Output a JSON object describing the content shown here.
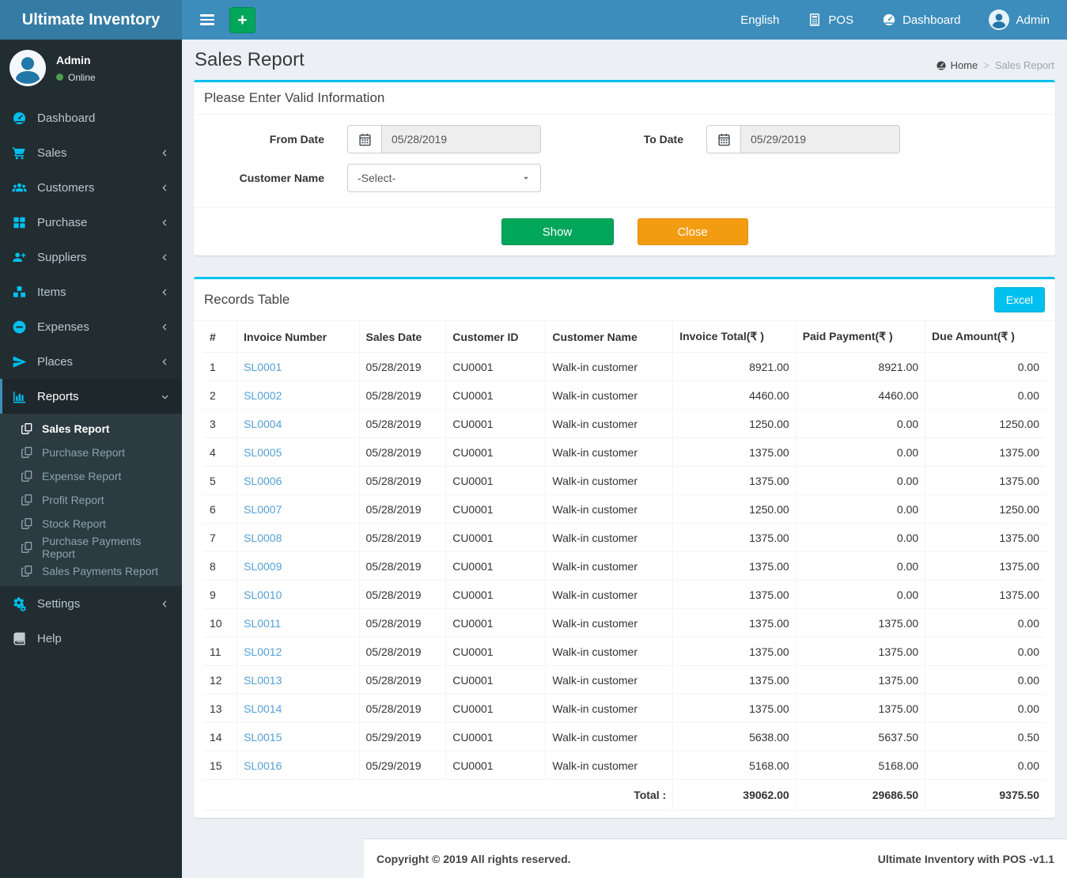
{
  "app": {
    "brand": "Ultimate Inventory",
    "footer_left": "Copyright © 2019 All rights reserved.",
    "footer_right": "Ultimate Inventory with POS -v1.1"
  },
  "topnav": {
    "language": "English",
    "pos": "POS",
    "dashboard": "Dashboard",
    "user": "Admin"
  },
  "user_panel": {
    "name": "Admin",
    "status": "Online"
  },
  "sidebar": {
    "items": [
      {
        "label": "Dashboard"
      },
      {
        "label": "Sales"
      },
      {
        "label": "Customers"
      },
      {
        "label": "Purchase"
      },
      {
        "label": "Suppliers"
      },
      {
        "label": "Items"
      },
      {
        "label": "Expenses"
      },
      {
        "label": "Places"
      },
      {
        "label": "Reports"
      },
      {
        "label": "Settings"
      },
      {
        "label": "Help"
      }
    ],
    "reports_submenu": [
      {
        "label": "Sales Report"
      },
      {
        "label": "Purchase Report"
      },
      {
        "label": "Expense Report"
      },
      {
        "label": "Profit Report"
      },
      {
        "label": "Stock Report"
      },
      {
        "label": "Purchase Payments Report"
      },
      {
        "label": "Sales Payments Report"
      }
    ]
  },
  "page": {
    "title": "Sales Report",
    "breadcrumb_home": "Home",
    "breadcrumb_current": "Sales Report"
  },
  "filter": {
    "title": "Please Enter Valid Information",
    "from_date_label": "From Date",
    "from_date_value": "05/28/2019",
    "to_date_label": "To Date",
    "to_date_value": "05/29/2019",
    "customer_label": "Customer Name",
    "customer_value": "-Select-",
    "show_label": "Show",
    "close_label": "Close"
  },
  "records": {
    "title": "Records Table",
    "excel_label": "Excel",
    "columns": [
      "#",
      "Invoice Number",
      "Sales Date",
      "Customer ID",
      "Customer Name",
      "Invoice Total(₹ )",
      "Paid Payment(₹ )",
      "Due Amount(₹ )"
    ],
    "rows": [
      {
        "num": "1",
        "invoice": "SL0001",
        "date": "05/28/2019",
        "customer_id": "CU0001",
        "customer_name": "Walk-in customer",
        "invoice_total": "8921.00",
        "paid_payment": "8921.00",
        "due_amount": "0.00"
      },
      {
        "num": "2",
        "invoice": "SL0002",
        "date": "05/28/2019",
        "customer_id": "CU0001",
        "customer_name": "Walk-in customer",
        "invoice_total": "4460.00",
        "paid_payment": "4460.00",
        "due_amount": "0.00"
      },
      {
        "num": "3",
        "invoice": "SL0004",
        "date": "05/28/2019",
        "customer_id": "CU0001",
        "customer_name": "Walk-in customer",
        "invoice_total": "1250.00",
        "paid_payment": "0.00",
        "due_amount": "1250.00"
      },
      {
        "num": "4",
        "invoice": "SL0005",
        "date": "05/28/2019",
        "customer_id": "CU0001",
        "customer_name": "Walk-in customer",
        "invoice_total": "1375.00",
        "paid_payment": "0.00",
        "due_amount": "1375.00"
      },
      {
        "num": "5",
        "invoice": "SL0006",
        "date": "05/28/2019",
        "customer_id": "CU0001",
        "customer_name": "Walk-in customer",
        "invoice_total": "1375.00",
        "paid_payment": "0.00",
        "due_amount": "1375.00"
      },
      {
        "num": "6",
        "invoice": "SL0007",
        "date": "05/28/2019",
        "customer_id": "CU0001",
        "customer_name": "Walk-in customer",
        "invoice_total": "1250.00",
        "paid_payment": "0.00",
        "due_amount": "1250.00"
      },
      {
        "num": "7",
        "invoice": "SL0008",
        "date": "05/28/2019",
        "customer_id": "CU0001",
        "customer_name": "Walk-in customer",
        "invoice_total": "1375.00",
        "paid_payment": "0.00",
        "due_amount": "1375.00"
      },
      {
        "num": "8",
        "invoice": "SL0009",
        "date": "05/28/2019",
        "customer_id": "CU0001",
        "customer_name": "Walk-in customer",
        "invoice_total": "1375.00",
        "paid_payment": "0.00",
        "due_amount": "1375.00"
      },
      {
        "num": "9",
        "invoice": "SL0010",
        "date": "05/28/2019",
        "customer_id": "CU0001",
        "customer_name": "Walk-in customer",
        "invoice_total": "1375.00",
        "paid_payment": "0.00",
        "due_amount": "1375.00"
      },
      {
        "num": "10",
        "invoice": "SL0011",
        "date": "05/28/2019",
        "customer_id": "CU0001",
        "customer_name": "Walk-in customer",
        "invoice_total": "1375.00",
        "paid_payment": "1375.00",
        "due_amount": "0.00"
      },
      {
        "num": "11",
        "invoice": "SL0012",
        "date": "05/28/2019",
        "customer_id": "CU0001",
        "customer_name": "Walk-in customer",
        "invoice_total": "1375.00",
        "paid_payment": "1375.00",
        "due_amount": "0.00"
      },
      {
        "num": "12",
        "invoice": "SL0013",
        "date": "05/28/2019",
        "customer_id": "CU0001",
        "customer_name": "Walk-in customer",
        "invoice_total": "1375.00",
        "paid_payment": "1375.00",
        "due_amount": "0.00"
      },
      {
        "num": "13",
        "invoice": "SL0014",
        "date": "05/28/2019",
        "customer_id": "CU0001",
        "customer_name": "Walk-in customer",
        "invoice_total": "1375.00",
        "paid_payment": "1375.00",
        "due_amount": "0.00"
      },
      {
        "num": "14",
        "invoice": "SL0015",
        "date": "05/29/2019",
        "customer_id": "CU0001",
        "customer_name": "Walk-in customer",
        "invoice_total": "5638.00",
        "paid_payment": "5637.50",
        "due_amount": "0.50"
      },
      {
        "num": "15",
        "invoice": "SL0016",
        "date": "05/29/2019",
        "customer_id": "CU0001",
        "customer_name": "Walk-in customer",
        "invoice_total": "5168.00",
        "paid_payment": "5168.00",
        "due_amount": "0.00"
      }
    ],
    "total": {
      "label": "Total :",
      "invoice_total": "39062.00",
      "paid_payment": "29686.50",
      "due_amount": "9375.50"
    }
  },
  "colors": {
    "navbar": "#3c8dbc",
    "logo_bg": "#357ca5",
    "sidebar_bg": "#222d32",
    "accent_cyan": "#00c0ef",
    "button_green": "#00a65a",
    "button_orange": "#f39c12",
    "link_blue": "#54a0d6"
  }
}
